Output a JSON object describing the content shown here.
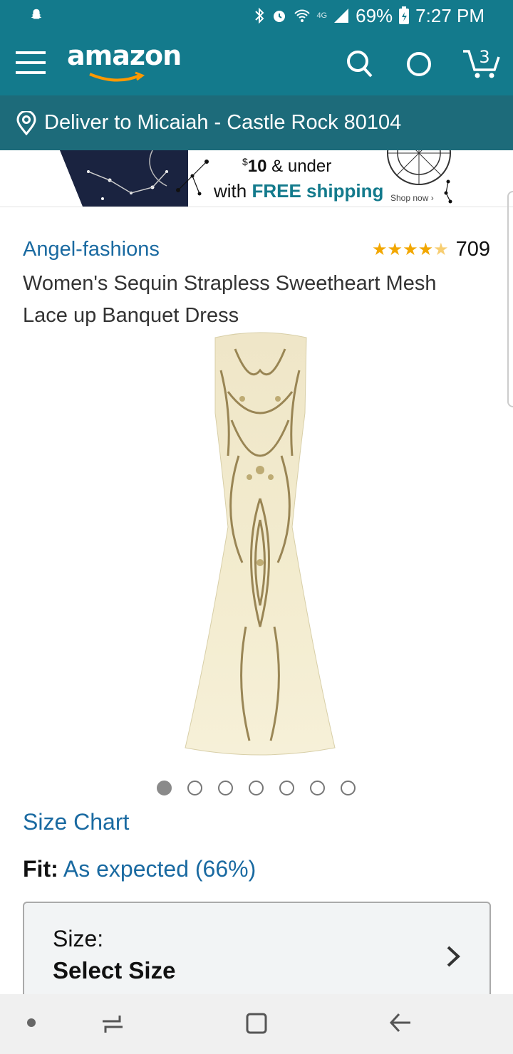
{
  "status_bar": {
    "battery": "69%",
    "time": "7:27 PM",
    "network": "4G"
  },
  "header": {
    "logo": "amazon",
    "cart_count": "3"
  },
  "deliver": {
    "text": "Deliver to Micaiah - Castle Rock 80104"
  },
  "banner": {
    "price_sup": "$",
    "price": "10",
    "price_tail": " & under",
    "shipping_prefix": "with ",
    "shipping_highlight": "FREE shipping",
    "shop_now": "Shop now ›"
  },
  "product": {
    "brand": "Angel-fashions",
    "rating_stars": 4.5,
    "rating_count": "709",
    "title": "Women's Sequin Strapless Sweetheart Mesh Lace up Banquet Dress",
    "image_count": 7,
    "active_image": 0
  },
  "size_chart": "Size Chart",
  "fit": {
    "label": "Fit:",
    "value": "As expected (66%)"
  },
  "size_selector": {
    "label": "Size:",
    "value": "Select Size"
  },
  "colors": {
    "header_teal": "#137a8c",
    "deliver_teal": "#1d6b7a",
    "link_blue": "#1a6aa1",
    "star_gold": "#f2a700"
  }
}
